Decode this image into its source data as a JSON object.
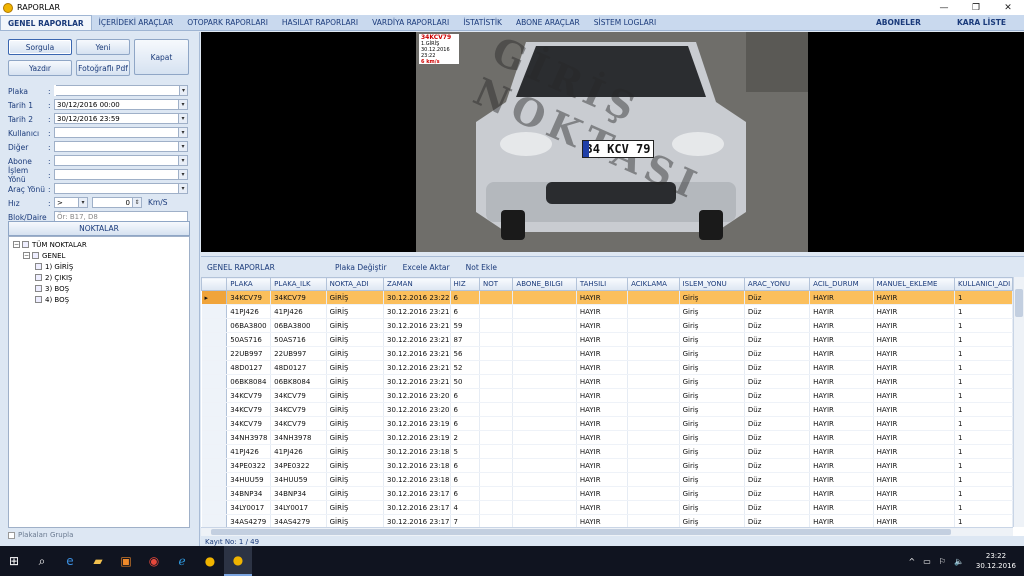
{
  "window": {
    "title": "RAPORLAR",
    "minimize": "—",
    "maximize": "❐",
    "close": "✕"
  },
  "menu": {
    "items": [
      "GENEL RAPORLAR",
      "İÇERİDEKİ ARAÇLAR",
      "OTOPARK RAPORLARI",
      "HASILAT RAPORLARI",
      "VARDİYA RAPORLARI",
      "İSTATİSTİK",
      "ABONE ARAÇLAR",
      "SİSTEM LOGLARI"
    ],
    "right": [
      "ABONELER",
      "KARA LİSTE"
    ],
    "active": "GENEL RAPORLAR"
  },
  "buttons": {
    "sorgula": "Sorgula",
    "yeni": "Yeni",
    "kapat": "Kapat",
    "yazdir": "Yazdır",
    "foto_pdf": "Fotoğraflı Pdf"
  },
  "filters": {
    "plaka": {
      "label": "Plaka",
      "value": ""
    },
    "tarih1": {
      "label": "Tarih 1",
      "value": "30/12/2016 00:00"
    },
    "tarih2": {
      "label": "Tarih 2",
      "value": "30/12/2016 23:59"
    },
    "kullanici": {
      "label": "Kullanıcı",
      "value": ""
    },
    "diger": {
      "label": "Diğer",
      "value": ""
    },
    "abone": {
      "label": "Abone",
      "value": ""
    },
    "islem_yonu": {
      "label": "İşlem Yönü",
      "value": ""
    },
    "arac_yonu": {
      "label": "Araç Yönü",
      "value": ""
    },
    "hiz": {
      "label": "Hız",
      "op": ">",
      "value": "0",
      "unit": "Km/S"
    },
    "blok": {
      "label": "Blok/Daire",
      "placeholder": "Ör: B17, D8"
    }
  },
  "noktalar": {
    "header": "NOKTALAR",
    "root": "TÜM NOKTALAR",
    "group": "GENEL",
    "items": [
      "1) GİRİŞ",
      "2) ÇIKIŞ",
      "3) BOŞ",
      "4) BOŞ"
    ]
  },
  "group_plates": "Plakaları Grupla",
  "camera": {
    "plate_text": "34KCV79",
    "direction": "1.GİRİŞ",
    "datetime": "30.12.2016 23:22",
    "speed": "6 km/s",
    "watermark": "GİRİŞ NOKTASI",
    "plate_visible": "34 KCV 79"
  },
  "grid": {
    "title": "GENEL RAPORLAR",
    "actions": [
      "Plaka Değiştir",
      "Excele Aktar",
      "Not Ekle"
    ],
    "columns": [
      "PLAKA",
      "PLAKA_ILK",
      "NOKTA_ADI",
      "ZAMAN",
      "HIZ",
      "NOT",
      "ABONE_BILGI",
      "TAHSILI",
      "ACIKLAMA",
      "ISLEM_YONU",
      "ARAC_YONU",
      "ACIL_DURUM",
      "MANUEL_EKLEME",
      "KULLANICI_ADI"
    ],
    "rows": [
      [
        "34KCV79",
        "34KCV79",
        "GİRİŞ",
        "30.12.2016 23:22",
        "6",
        "",
        "",
        "HAYIR",
        "",
        "Giriş",
        "Düz",
        "HAYIR",
        "HAYIR",
        "1"
      ],
      [
        "41PJ426",
        "41PJ426",
        "GİRİŞ",
        "30.12.2016 23:21",
        "6",
        "",
        "",
        "HAYIR",
        "",
        "Giriş",
        "Düz",
        "HAYIR",
        "HAYIR",
        "1"
      ],
      [
        "06BA3800",
        "06BA3800",
        "GİRİŞ",
        "30.12.2016 23:21",
        "59",
        "",
        "",
        "HAYIR",
        "",
        "Giriş",
        "Düz",
        "HAYIR",
        "HAYIR",
        "1"
      ],
      [
        "50AS716",
        "50AS716",
        "GİRİŞ",
        "30.12.2016 23:21",
        "87",
        "",
        "",
        "HAYIR",
        "",
        "Giriş",
        "Düz",
        "HAYIR",
        "HAYIR",
        "1"
      ],
      [
        "22UB997",
        "22UB997",
        "GİRİŞ",
        "30.12.2016 23:21",
        "56",
        "",
        "",
        "HAYIR",
        "",
        "Giriş",
        "Düz",
        "HAYIR",
        "HAYIR",
        "1"
      ],
      [
        "48D0127",
        "48D0127",
        "GİRİŞ",
        "30.12.2016 23:21",
        "52",
        "",
        "",
        "HAYIR",
        "",
        "Giriş",
        "Düz",
        "HAYIR",
        "HAYIR",
        "1"
      ],
      [
        "06BK8084",
        "06BK8084",
        "GİRİŞ",
        "30.12.2016 23:21",
        "50",
        "",
        "",
        "HAYIR",
        "",
        "Giriş",
        "Düz",
        "HAYIR",
        "HAYIR",
        "1"
      ],
      [
        "34KCV79",
        "34KCV79",
        "GİRİŞ",
        "30.12.2016 23:20",
        "6",
        "",
        "",
        "HAYIR",
        "",
        "Giriş",
        "Düz",
        "HAYIR",
        "HAYIR",
        "1"
      ],
      [
        "34KCV79",
        "34KCV79",
        "GİRİŞ",
        "30.12.2016 23:20",
        "6",
        "",
        "",
        "HAYIR",
        "",
        "Giriş",
        "Düz",
        "HAYIR",
        "HAYIR",
        "1"
      ],
      [
        "34KCV79",
        "34KCV79",
        "GİRİŞ",
        "30.12.2016 23:19",
        "6",
        "",
        "",
        "HAYIR",
        "",
        "Giriş",
        "Düz",
        "HAYIR",
        "HAYIR",
        "1"
      ],
      [
        "34NH3978",
        "34NH3978",
        "GİRİŞ",
        "30.12.2016 23:19",
        "2",
        "",
        "",
        "HAYIR",
        "",
        "Giriş",
        "Düz",
        "HAYIR",
        "HAYIR",
        "1"
      ],
      [
        "41PJ426",
        "41PJ426",
        "GİRİŞ",
        "30.12.2016 23:18",
        "5",
        "",
        "",
        "HAYIR",
        "",
        "Giriş",
        "Düz",
        "HAYIR",
        "HAYIR",
        "1"
      ],
      [
        "34PE0322",
        "34PE0322",
        "GİRİŞ",
        "30.12.2016 23:18",
        "6",
        "",
        "",
        "HAYIR",
        "",
        "Giriş",
        "Düz",
        "HAYIR",
        "HAYIR",
        "1"
      ],
      [
        "34HUU59",
        "34HUU59",
        "GİRİŞ",
        "30.12.2016 23:18",
        "6",
        "",
        "",
        "HAYIR",
        "",
        "Giriş",
        "Düz",
        "HAYIR",
        "HAYIR",
        "1"
      ],
      [
        "34BNP34",
        "34BNP34",
        "GİRİŞ",
        "30.12.2016 23:17",
        "6",
        "",
        "",
        "HAYIR",
        "",
        "Giriş",
        "Düz",
        "HAYIR",
        "HAYIR",
        "1"
      ],
      [
        "34LY0017",
        "34LY0017",
        "GİRİŞ",
        "30.12.2016 23:17",
        "4",
        "",
        "",
        "HAYIR",
        "",
        "Giriş",
        "Düz",
        "HAYIR",
        "HAYIR",
        "1"
      ],
      [
        "34AS4279",
        "34AS4279",
        "GİRİŞ",
        "30.12.2016 23:17",
        "7",
        "",
        "",
        "HAYIR",
        "",
        "Giriş",
        "Düz",
        "HAYIR",
        "HAYIR",
        "1"
      ]
    ],
    "selected_row": 0,
    "status": "Kayıt No: 1 / 49"
  },
  "taskbar": {
    "icons": [
      "windows-start-icon",
      "search-icon",
      "edge-icon",
      "file-explorer-icon",
      "outlook-icon",
      "chrome-icon",
      "ie-icon",
      "app-icon",
      "app-active-icon"
    ],
    "time": "23:22",
    "date": "30.12.2016",
    "tray": [
      "^",
      "▭",
      "⚐",
      "🔈"
    ]
  },
  "colors": {
    "selection": "#fbbf5c",
    "menu_bg": "#c9d9ee",
    "panel_bg": "#dde7f3",
    "taskbar": "#101420"
  }
}
